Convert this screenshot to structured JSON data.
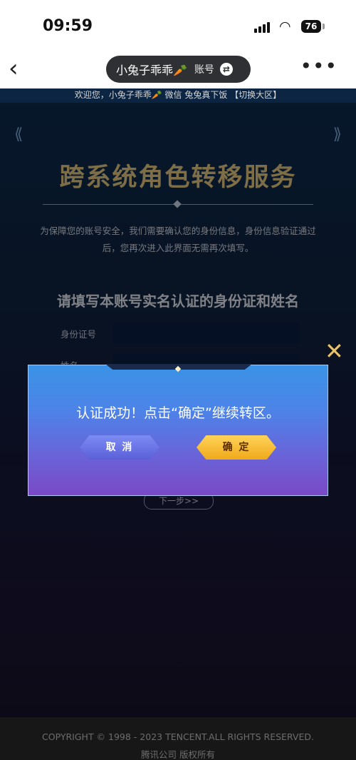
{
  "status_bar": {
    "time": "09:59",
    "battery": "76"
  },
  "nav": {
    "account_name": "小兔子乖乖🥕",
    "account_label": "账号",
    "more_label": "•••"
  },
  "page": {
    "welcome": "欢迎您，小兔子乖乖🥕 微信 兔兔真下饭 【切换大区】",
    "title": "跨系统角色转移服务",
    "notice": "为保障您的账号安全，我们需要确认您的身份信息，身份信息验证通过后，您再次进入此界面无需再次填写。",
    "subtitle": "请填写本账号实名认证的身份证和姓名",
    "fields": [
      {
        "label": "身份证号"
      },
      {
        "label": "姓名"
      }
    ],
    "next_button": "下一步>>"
  },
  "footer": {
    "copyright": "COPYRIGHT © 1998 - 2023 TENCENT.ALL RIGHTS RESERVED.",
    "company": "腾讯公司 版权所有"
  },
  "modal": {
    "message": "认证成功！点击“确定”继续转区。",
    "cancel_label": "取 消",
    "confirm_label": "确 定"
  },
  "colors": {
    "modal_top": "#3a93e6",
    "modal_bottom": "#7a49c6",
    "confirm": "#f0a91a",
    "title_gold": "#e4c884"
  }
}
